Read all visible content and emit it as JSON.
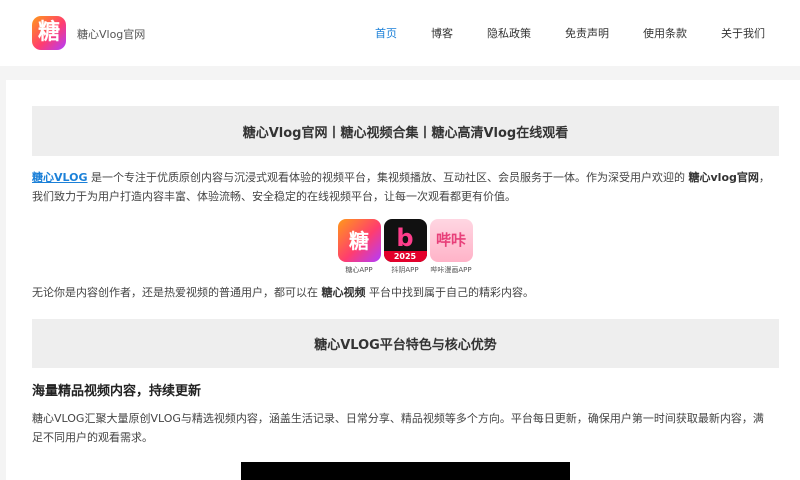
{
  "header": {
    "site_name": "糖心Vlog官网",
    "logo_glyph": "糖",
    "nav": [
      {
        "label": "首页",
        "active": true
      },
      {
        "label": "博客",
        "active": false
      },
      {
        "label": "隐私政策",
        "active": false
      },
      {
        "label": "免责声明",
        "active": false
      },
      {
        "label": "使用条款",
        "active": false
      },
      {
        "label": "关于我们",
        "active": false
      }
    ]
  },
  "main": {
    "banner_title": "糖心Vlog官网丨糖心视频合集丨糖心高清Vlog在线观看",
    "intro": {
      "link": "糖心VLOG",
      "text1": " 是一个专注于优质原创内容与沉浸式观看体验的视频平台，集视频播放、互动社区、会员服务于一体。作为深受用户欢迎的 ",
      "bold": "糖心vlog官网",
      "text2": "，我们致力于为用户打造内容丰富、体验流畅、安全稳定的在线视频平台，让每一次观看都更有价值。"
    },
    "apps": [
      {
        "glyph": "糖",
        "label": "糖心APP",
        "icon": "tangxin-app-icon"
      },
      {
        "glyph": "b",
        "badge": "2025",
        "label": "抖阴APP",
        "icon": "douyin-app-icon"
      },
      {
        "glyph": "哔咔",
        "label": "哔咔漫画APP",
        "icon": "bika-app-icon"
      }
    ],
    "para2": {
      "text1": "无论你是内容创作者，还是热爱视频的普通用户，都可以在 ",
      "bold": "糖心视频",
      "text2": " 平台中找到属于自己的精彩内容。"
    },
    "section_title": "糖心VLOG平台特色与核心优势",
    "feature_title": "海量精品视频内容，持续更新",
    "feature_text": "糖心VLOG汇聚大量原创VLOG与精选视频内容，涵盖生活记录、日常分享、精品视频等多个方向。平台每日更新，确保用户第一时间获取最新内容，满足不同用户的观看需求。"
  },
  "colors": {
    "accent": "#1b80d8",
    "banner_bg": "#eeeeee",
    "page_bg": "#f4f4f4"
  }
}
